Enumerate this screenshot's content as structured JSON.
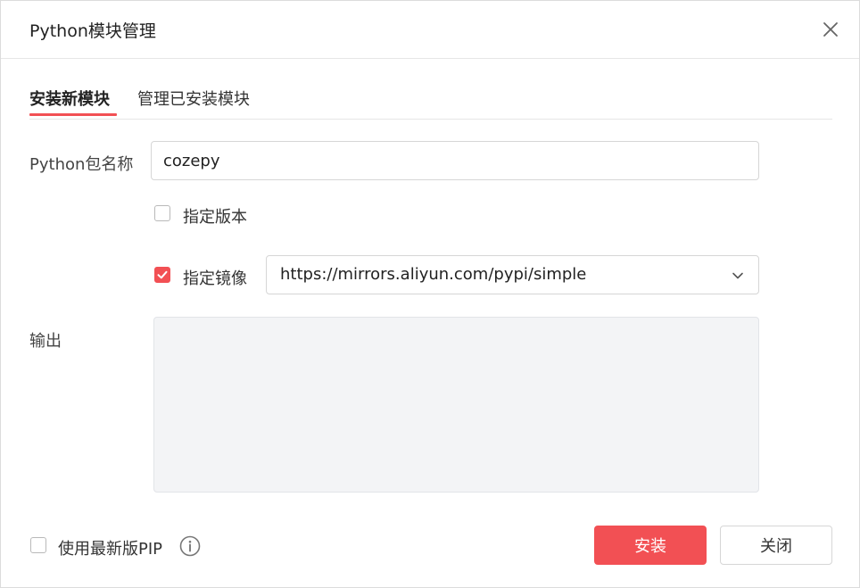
{
  "dialog": {
    "title": "Python模块管理",
    "close_icon": "close-icon"
  },
  "tabs": [
    {
      "label": "安装新模块",
      "active": true
    },
    {
      "label": "管理已安装模块",
      "active": false
    }
  ],
  "form": {
    "package_label": "Python包名称",
    "package_value": "cozepy",
    "version_checkbox": {
      "label": "指定版本",
      "checked": false
    },
    "mirror_checkbox": {
      "label": "指定镜像",
      "checked": true
    },
    "mirror_select_value": "https://mirrors.aliyun.com/pypi/simple",
    "output_label": "输出",
    "output_text": ""
  },
  "footer": {
    "latest_pip_checkbox": {
      "label": "使用最新版PIP",
      "checked": false
    },
    "info_icon": "info-icon",
    "install_label": "安装",
    "close_label": "关闭"
  },
  "colors": {
    "accent": "#f25054",
    "output_bg": "#f3f4f6",
    "border": "#d6d6d6"
  }
}
